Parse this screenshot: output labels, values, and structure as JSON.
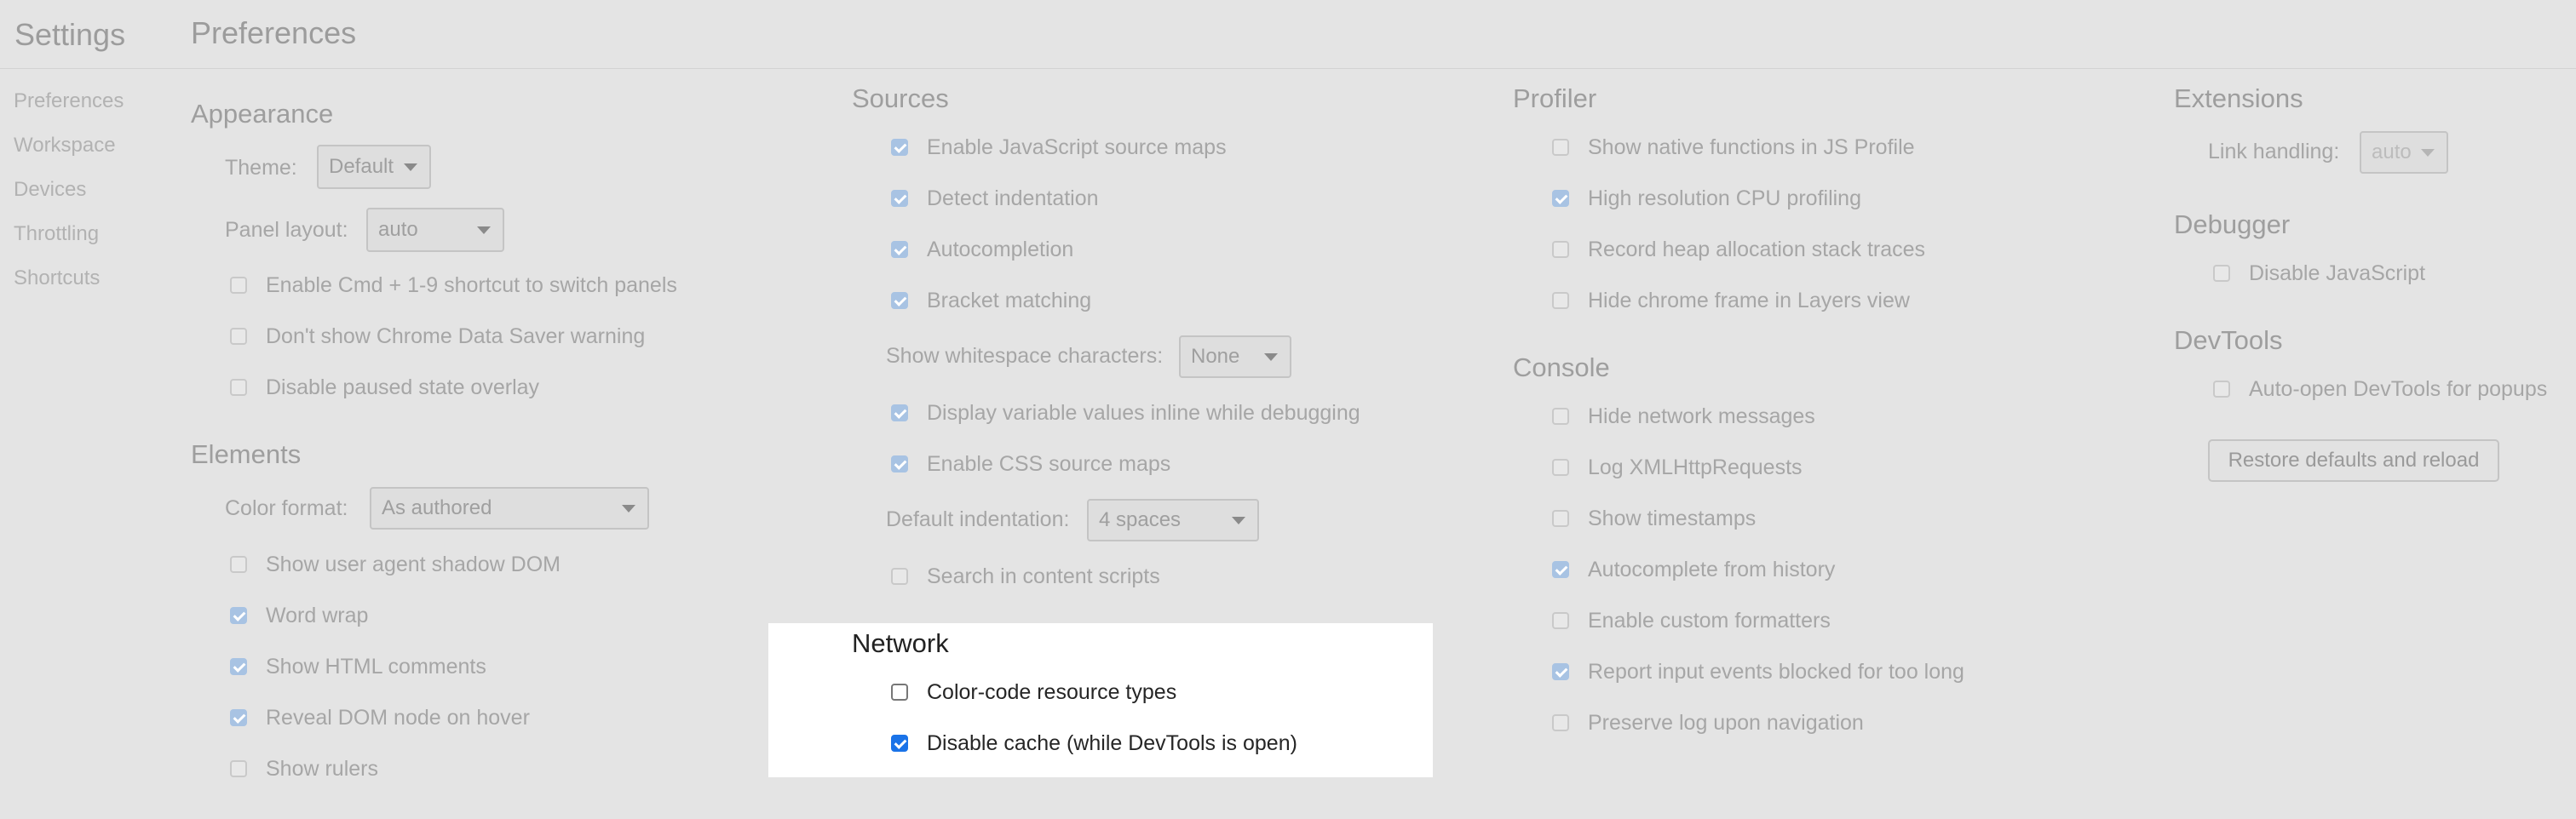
{
  "sidebar": {
    "title": "Settings",
    "items": [
      {
        "label": "Preferences"
      },
      {
        "label": "Workspace"
      },
      {
        "label": "Devices"
      },
      {
        "label": "Throttling"
      },
      {
        "label": "Shortcuts"
      }
    ]
  },
  "page_title": "Preferences",
  "appearance": {
    "header": "Appearance",
    "theme_label": "Theme:",
    "theme_value": "Default",
    "panel_layout_label": "Panel layout:",
    "panel_layout_value": "auto",
    "options": [
      {
        "label": "Enable Cmd + 1-9 shortcut to switch panels",
        "checked": false
      },
      {
        "label": "Don't show Chrome Data Saver warning",
        "checked": false
      },
      {
        "label": "Disable paused state overlay",
        "checked": false
      }
    ]
  },
  "elements": {
    "header": "Elements",
    "color_format_label": "Color format:",
    "color_format_value": "As authored",
    "options": [
      {
        "label": "Show user agent shadow DOM",
        "checked": false
      },
      {
        "label": "Word wrap",
        "checked": true
      },
      {
        "label": "Show HTML comments",
        "checked": true
      },
      {
        "label": "Reveal DOM node on hover",
        "checked": true
      },
      {
        "label": "Show rulers",
        "checked": false
      }
    ]
  },
  "sources": {
    "header": "Sources",
    "options": [
      {
        "label": "Enable JavaScript source maps",
        "checked": true
      },
      {
        "label": "Detect indentation",
        "checked": true
      },
      {
        "label": "Autocompletion",
        "checked": true
      },
      {
        "label": "Bracket matching",
        "checked": true
      }
    ],
    "whitespace_label": "Show whitespace characters:",
    "whitespace_value": "None",
    "options2": [
      {
        "label": "Display variable values inline while debugging",
        "checked": true
      },
      {
        "label": "Enable CSS source maps",
        "checked": true
      }
    ],
    "indentation_label": "Default indentation:",
    "indentation_value": "4 spaces",
    "options3": [
      {
        "label": "Search in content scripts",
        "checked": false
      }
    ]
  },
  "network": {
    "header": "Network",
    "options": [
      {
        "label": "Color-code resource types",
        "checked": false
      },
      {
        "label": "Disable cache (while DevTools is open)",
        "checked": true
      }
    ]
  },
  "profiler": {
    "header": "Profiler",
    "options": [
      {
        "label": "Show native functions in JS Profile",
        "checked": false
      },
      {
        "label": "High resolution CPU profiling",
        "checked": true
      },
      {
        "label": "Record heap allocation stack traces",
        "checked": false
      },
      {
        "label": "Hide chrome frame in Layers view",
        "checked": false
      }
    ]
  },
  "console": {
    "header": "Console",
    "options": [
      {
        "label": "Hide network messages",
        "checked": false
      },
      {
        "label": "Log XMLHttpRequests",
        "checked": false
      },
      {
        "label": "Show timestamps",
        "checked": false
      },
      {
        "label": "Autocomplete from history",
        "checked": true
      },
      {
        "label": "Enable custom formatters",
        "checked": false
      },
      {
        "label": "Report input events blocked for too long",
        "checked": true
      },
      {
        "label": "Preserve log upon navigation",
        "checked": false
      }
    ]
  },
  "extensions": {
    "header": "Extensions",
    "link_handling_label": "Link handling:",
    "link_handling_value": "auto"
  },
  "debugger": {
    "header": "Debugger",
    "options": [
      {
        "label": "Disable JavaScript",
        "checked": false
      }
    ]
  },
  "devtools": {
    "header": "DevTools",
    "options": [
      {
        "label": "Auto-open DevTools for popups",
        "checked": false
      }
    ],
    "restore_button": "Restore defaults and reload"
  }
}
